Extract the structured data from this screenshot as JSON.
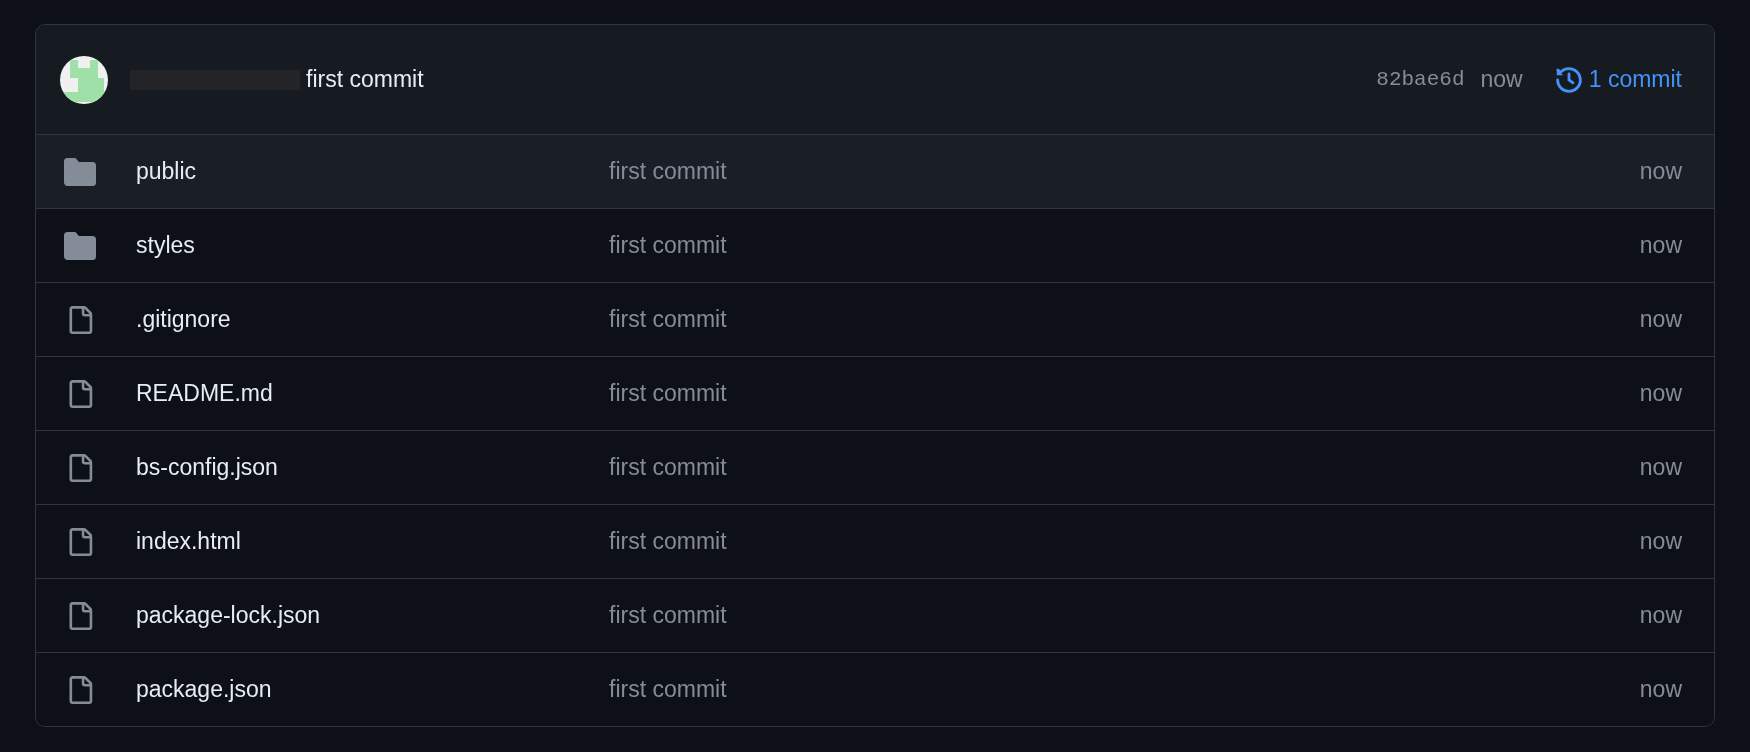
{
  "latest_commit": {
    "author_redacted": true,
    "message": "first commit",
    "hash": "82bae6d",
    "time": "now",
    "history_link": "1 commit"
  },
  "files": [
    {
      "kind": "folder",
      "name": "public",
      "message": "first commit",
      "time": "now",
      "selected": true
    },
    {
      "kind": "folder",
      "name": "styles",
      "message": "first commit",
      "time": "now",
      "selected": false
    },
    {
      "kind": "file",
      "name": ".gitignore",
      "message": "first commit",
      "time": "now",
      "selected": false
    },
    {
      "kind": "file",
      "name": "README.md",
      "message": "first commit",
      "time": "now",
      "selected": false
    },
    {
      "kind": "file",
      "name": "bs-config.json",
      "message": "first commit",
      "time": "now",
      "selected": false
    },
    {
      "kind": "file",
      "name": "index.html",
      "message": "first commit",
      "time": "now",
      "selected": false
    },
    {
      "kind": "file",
      "name": "package-lock.json",
      "message": "first commit",
      "time": "now",
      "selected": false
    },
    {
      "kind": "file",
      "name": "package.json",
      "message": "first commit",
      "time": "now",
      "selected": false
    }
  ]
}
